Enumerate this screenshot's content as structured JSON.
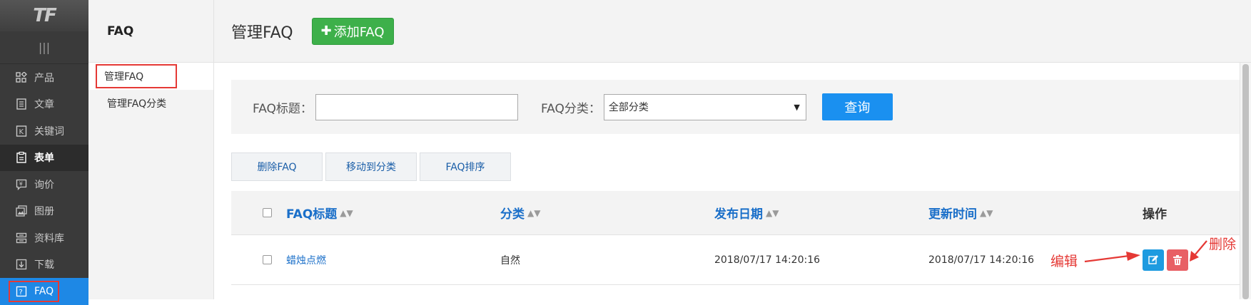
{
  "logo": "TF",
  "sidebar": {
    "items": [
      {
        "label": "产品",
        "icon": "products-icon"
      },
      {
        "label": "文章",
        "icon": "article-icon"
      },
      {
        "label": "关键词",
        "icon": "keyword-icon"
      },
      {
        "label": "表单",
        "icon": "form-icon"
      },
      {
        "label": "询价",
        "icon": "inquiry-icon"
      },
      {
        "label": "图册",
        "icon": "album-icon"
      },
      {
        "label": "资料库",
        "icon": "database-icon"
      },
      {
        "label": "下载",
        "icon": "download-icon"
      },
      {
        "label": "FAQ",
        "icon": "faq-icon"
      }
    ]
  },
  "subnav": {
    "title": "FAQ",
    "items": [
      {
        "label": "管理FAQ"
      },
      {
        "label": "管理FAQ分类"
      }
    ]
  },
  "header": {
    "title": "管理FAQ",
    "add_button": "添加FAQ"
  },
  "filter": {
    "title_label": "FAQ标题：",
    "title_value": "",
    "category_label": "FAQ分类：",
    "category_value": "全部分类",
    "query_button": "查询"
  },
  "actions": {
    "delete": "删除FAQ",
    "move": "移动到分类",
    "sort": "FAQ排序"
  },
  "table": {
    "columns": [
      "FAQ标题",
      "分类",
      "发布日期",
      "更新时间",
      "操作"
    ],
    "rows": [
      {
        "title": "蜡烛点燃",
        "category": "自然",
        "published": "2018/07/17 14:20:16",
        "updated": "2018/07/17 14:20:16"
      }
    ]
  },
  "annotations": {
    "edit": "编辑",
    "delete": "删除"
  },
  "colors": {
    "accent": "#1a90f0",
    "add_green": "#3db04a",
    "edit_blue": "#1e9be0",
    "delete_red": "#e86065",
    "highlight_red": "#e53935"
  }
}
